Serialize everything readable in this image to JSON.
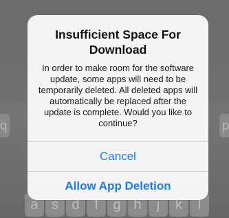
{
  "alert": {
    "title": "Insufficient Space For Download",
    "message": "In order to make room for the software update, some apps will need to be temporarily deleted. All deleted apps will automatically be replaced after the update is complete. Would you like to continue?",
    "cancel_label": "Cancel",
    "allow_label": "Allow App Deletion"
  },
  "keyboard": {
    "row_left": "q",
    "row_right": "p",
    "bottom_keys": [
      "a",
      "s",
      "d",
      "f",
      "g",
      "h",
      "j",
      "k",
      "l"
    ]
  },
  "colors": {
    "accent": "#1f7af2",
    "dialog_bg": "#f4f4f5",
    "overlay": "#707072"
  }
}
